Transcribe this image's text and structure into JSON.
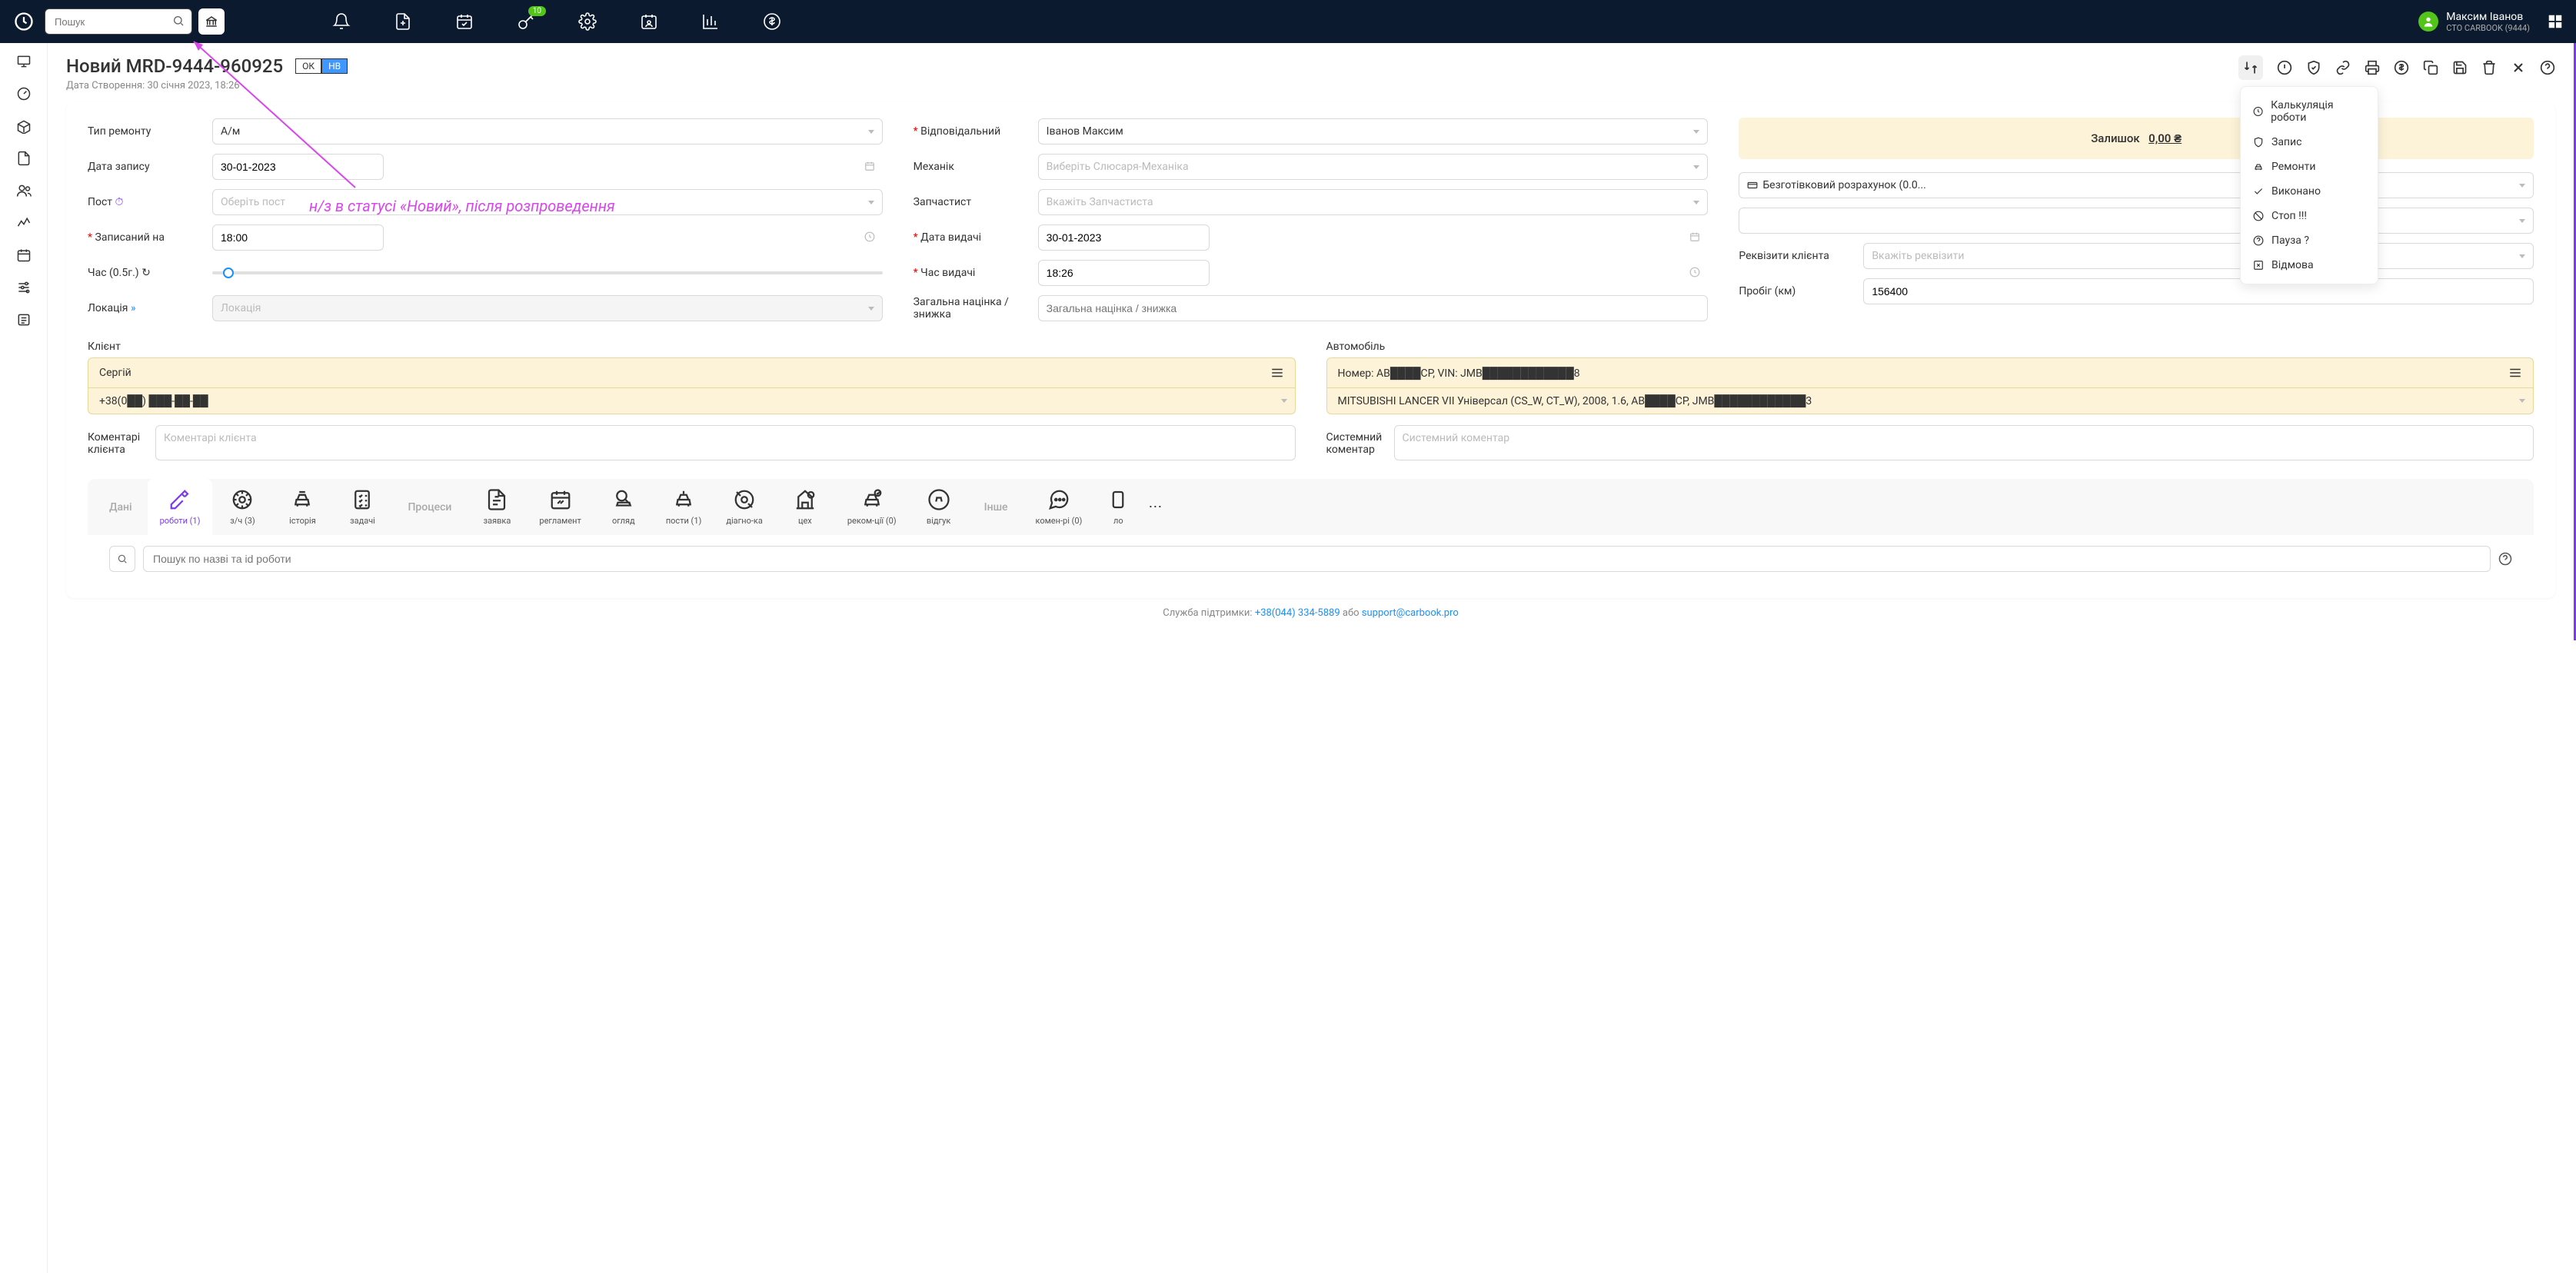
{
  "topbar": {
    "search_placeholder": "Пошук",
    "key_badge": "10",
    "user_name": "Максим Іванов",
    "user_sub": "СТО CARBOOK (9444)"
  },
  "page": {
    "title": "Новий MRD-9444-960925",
    "badge_ok": "ОК",
    "badge_nv": "НВ",
    "subtitle": "Дата Створення: 30 січня 2023, 18:26"
  },
  "dropdown": {
    "items": [
      "Калькуляція роботи",
      "Запис",
      "Ремонти",
      "Виконано",
      "Стоп !!!",
      "Пауза ?",
      "Відмова"
    ]
  },
  "form": {
    "repair_type_label": "Тип ремонту",
    "repair_type_value": "А/м",
    "record_date_label": "Дата запису",
    "record_date_value": "30-01-2023",
    "post_label": "Пост",
    "post_placeholder": "Оберіть пост",
    "booked_label": "Записаний на",
    "booked_value": "18:00",
    "time_label": "Час (0.5г.)",
    "location_label": "Локація",
    "location_placeholder": "Локація",
    "responsible_label": "Відповідальний",
    "responsible_value": "Іванов Максим",
    "mechanic_label": "Механік",
    "mechanic_placeholder": "Виберіть Слюсаря-Механіка",
    "parts_label": "Запчастист",
    "parts_placeholder": "Вкажіть Запчастиста",
    "issue_date_label": "Дата видачі",
    "issue_date_value": "30-01-2023",
    "issue_time_label": "Час видачі",
    "issue_time_value": "18:26",
    "margin_label": "Загальна націнка / знижка",
    "margin_placeholder": "Загальна націнка / знижка",
    "balance_label": "Залишок",
    "balance_value": "0,00 ₴",
    "payment_method": "Безготівковий розрахунок (0.0...",
    "req_label": "Реквізити клієнта",
    "req_placeholder": "Вкажіть реквізити",
    "mileage_label": "Пробіг (км)",
    "mileage_value": "156400"
  },
  "client": {
    "label": "Клієнт",
    "name": "Сергій",
    "phone": "+38(0██) ███-██-██",
    "comment_label": "Коментарі клієнта",
    "comment_placeholder": "Коментарі клієнта"
  },
  "car": {
    "label": "Автомобіль",
    "line1": "Номер: AB████CP,  VIN: JMB████████████8",
    "line2": "MITSUBISHI LANCER VII Універсал (CS_W, CT_W), 2008, 1.6, AB████CP, JMB████████████3",
    "comment_label": "Системний коментар",
    "comment_placeholder": "Системний коментар"
  },
  "tabs": {
    "group1": "Дані",
    "group2": "Процеси",
    "group3": "Інше",
    "items": [
      "роботи (1)",
      "з/ч (3)",
      "історія",
      "задачі",
      "заявка",
      "регламент",
      "огляд",
      "пости (1)",
      "діагно-ка",
      "цех",
      "реком-ції (0)",
      "відгук",
      "комен-рі (0)",
      "ло"
    ]
  },
  "search_tab": {
    "placeholder": "Пошук по назві та id роботи"
  },
  "footer": {
    "text_prefix": "Служба підтримки: ",
    "phone": "+38(044) 334-5889",
    "middle": " або ",
    "email": "support@carbook.pro"
  },
  "annotation": "н/з в статусі «Новий», після розпроведення"
}
